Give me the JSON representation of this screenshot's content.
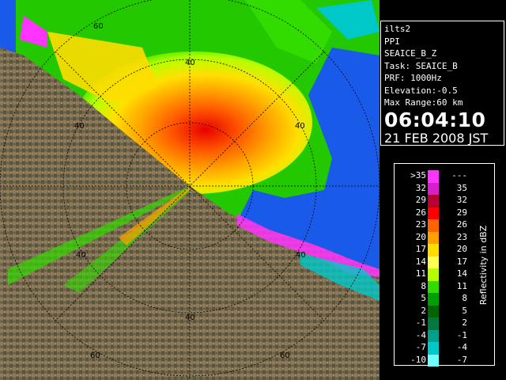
{
  "info": {
    "radar_name": "ilts2",
    "scan_type": "PPI",
    "product": "SEAICE_B_Z",
    "task": "Task: SEAICE_B",
    "prf": "PRF: 1000Hz",
    "elevation": "Elevation:-0.5",
    "max_range": "Max Range:60 km",
    "time": "06:04:10",
    "date": "21 FEB 2008 JST"
  },
  "range_ring_labels": {
    "ring40_top": "40",
    "ring40_left": "40",
    "ring40_right": "40",
    "ring40_bottom": "40",
    "ring40_lower_left": "40",
    "ring40_lower_right": "40",
    "ring60_top_left": "60",
    "ring60_bottom_left": "60",
    "ring60_bottom_right": "60"
  },
  "legend": {
    "unit_label": "Reflectivity in dBZ",
    "bins": [
      {
        "low": ">35",
        "high": "---",
        "color": "#ff33ff"
      },
      {
        "low": "32",
        "high": "35",
        "color": "#d81ec8"
      },
      {
        "low": "29",
        "high": "32",
        "color": "#b40032"
      },
      {
        "low": "26",
        "high": "29",
        "color": "#ff0000"
      },
      {
        "low": "23",
        "high": "26",
        "color": "#ff6400"
      },
      {
        "low": "20",
        "high": "23",
        "color": "#ffa000"
      },
      {
        "low": "17",
        "high": "20",
        "color": "#ffdc00"
      },
      {
        "low": "14",
        "high": "17",
        "color": "#ffff50"
      },
      {
        "low": "11",
        "high": "14",
        "color": "#b4ff00"
      },
      {
        "low": "8",
        "high": "11",
        "color": "#32dc00"
      },
      {
        "low": "5",
        "high": "8",
        "color": "#00a000"
      },
      {
        "low": "2",
        "high": "5",
        "color": "#006400"
      },
      {
        "low": "-1",
        "high": "2",
        "color": "#007840"
      },
      {
        "low": "-4",
        "high": "-1",
        "color": "#00a08c"
      },
      {
        "low": "-7",
        "high": "-4",
        "color": "#00c8c8"
      },
      {
        "low": "-10",
        "high": "-7",
        "color": "#6effff"
      }
    ]
  }
}
